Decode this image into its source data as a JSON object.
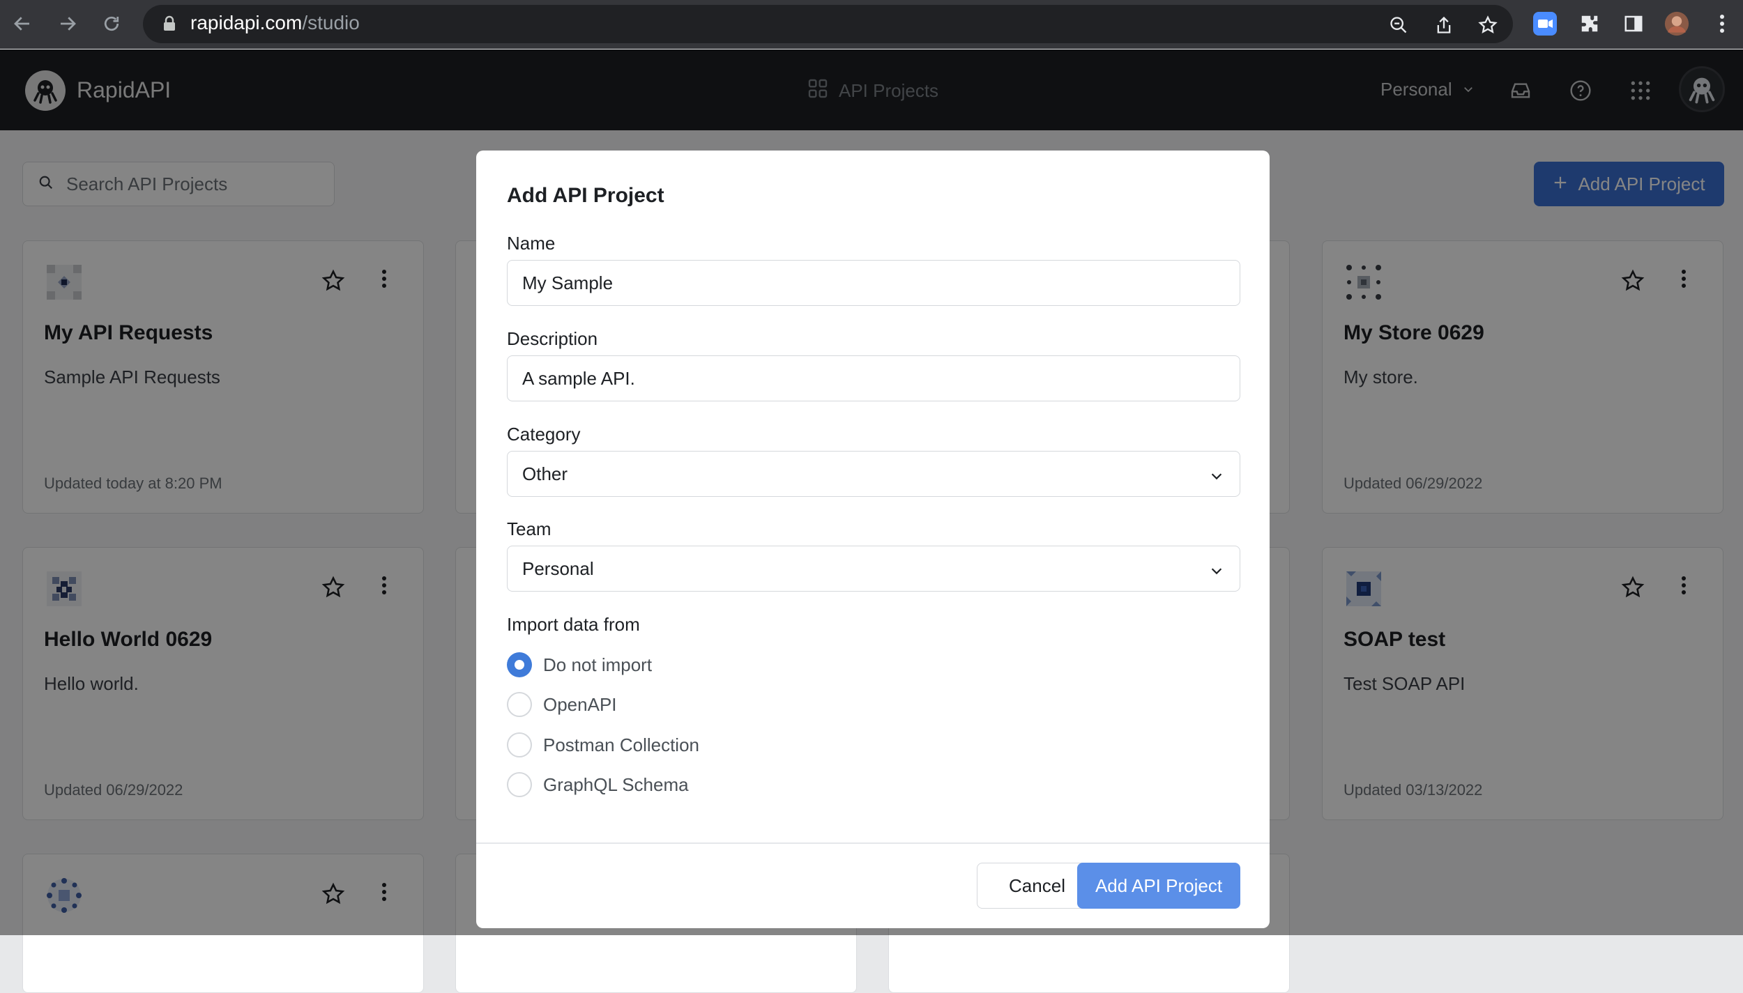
{
  "browser": {
    "url_host": "rapidapi.com",
    "url_path": "/studio"
  },
  "app": {
    "brand": "RapidAPI",
    "center_tab": "API Projects",
    "team_selector": "Personal"
  },
  "page": {
    "search_placeholder": "Search API Projects",
    "add_button": "Add API Project"
  },
  "cards": [
    {
      "title": "My API Requests",
      "description": "Sample API Requests",
      "updated": "Updated today at 8:20 PM"
    },
    {
      "title": "My Store 0629",
      "description": "My store.",
      "updated": "Updated 06/29/2022"
    },
    {
      "title": "Hello World 0629",
      "description": "Hello world.",
      "updated": "Updated 06/29/2022"
    },
    {
      "title": "SOAP test",
      "description": "Test SOAP API",
      "updated": "Updated 03/13/2022"
    }
  ],
  "modal": {
    "title": "Add API Project",
    "name_label": "Name",
    "name_value": "My Sample",
    "description_label": "Description",
    "description_value": "A sample API.",
    "category_label": "Category",
    "category_value": "Other",
    "team_label": "Team",
    "team_value": "Personal",
    "import_label": "Import data from",
    "import_options": [
      "Do not import",
      "OpenAPI",
      "Postman Collection",
      "GraphQL Schema"
    ],
    "cancel": "Cancel",
    "submit": "Add API Project"
  },
  "colors": {
    "primary": "#3b6fd4",
    "primary_light": "#5b8fe8",
    "radio_selected": "#3f7bd9",
    "app_bar": "#1d2024"
  }
}
